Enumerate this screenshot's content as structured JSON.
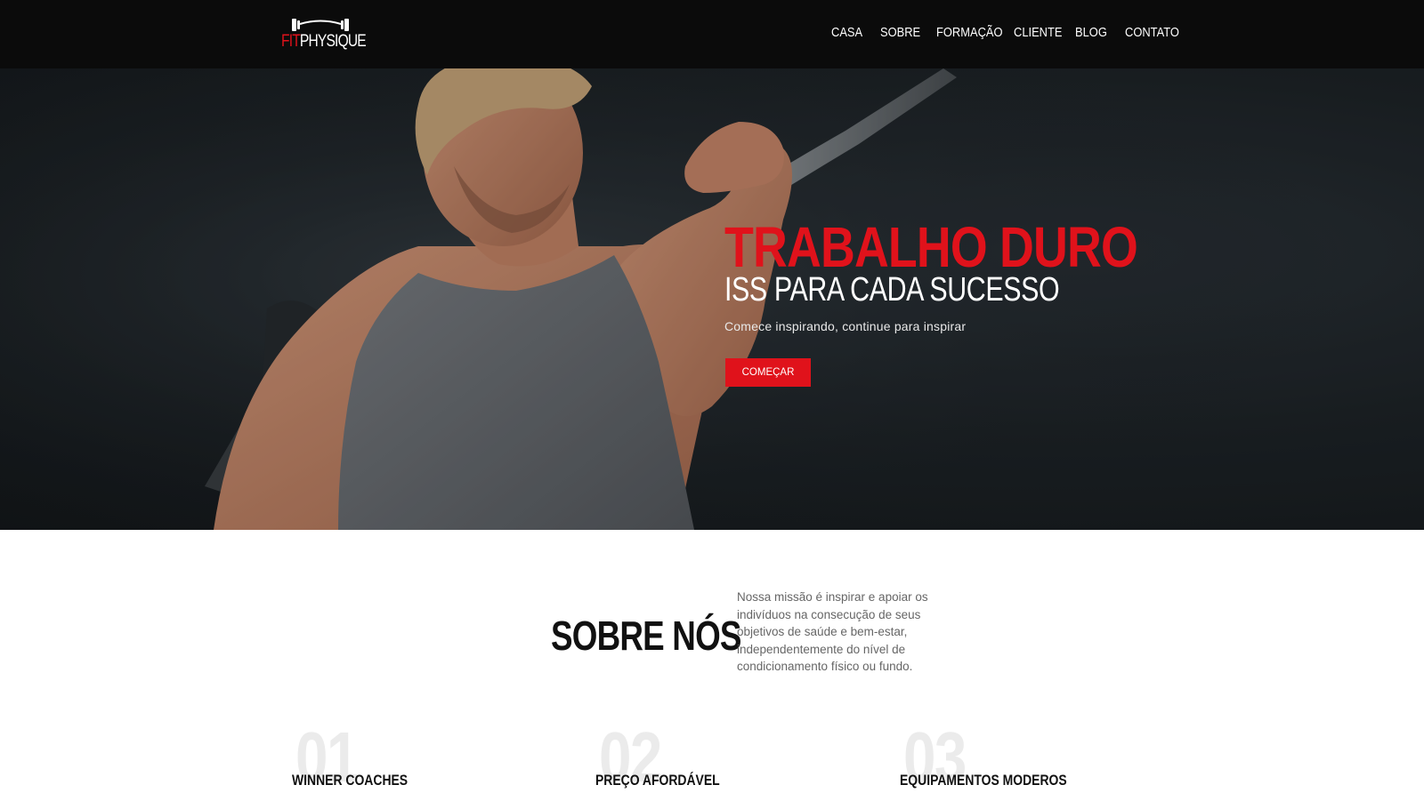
{
  "brand": {
    "logo_fit": "FIT",
    "logo_physique": "PHYSIQUE",
    "accent_color": "#e0121b",
    "logo_icon": "barbell-icon"
  },
  "nav": {
    "items": [
      {
        "label": "CASA"
      },
      {
        "label": "SOBRE"
      },
      {
        "label": "FORMAÇÃO"
      },
      {
        "label": "CLIENTE"
      },
      {
        "label": "BLOG"
      },
      {
        "label": "CONTATO"
      }
    ]
  },
  "hero": {
    "title": "TRABALHO DURO",
    "subtitle": "ISS PARA CADA SUCESSO",
    "tagline": "Comece inspirando, continue para inspirar",
    "button_label": "COMEÇAR"
  },
  "about": {
    "heading": "SOBRE NÓS",
    "text": "Nossa missão é inspirar e apoiar os indivíduos na consecução de seus objetivos de saúde e bem-estar, independentemente do nível de condicionamento físico ou fundo."
  },
  "features": [
    {
      "number": "01",
      "title": "WINNER COACHES"
    },
    {
      "number": "02",
      "title": "PREÇO AFORDÁVEL"
    },
    {
      "number": "03",
      "title": "EQUIPAMENTOS MODEROS"
    }
  ]
}
